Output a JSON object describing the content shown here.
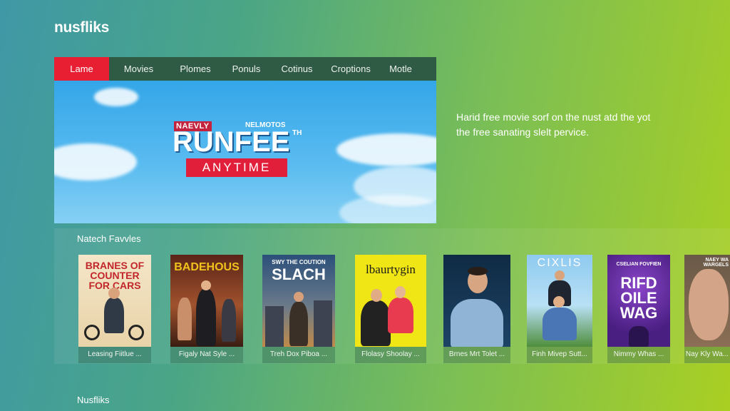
{
  "app": {
    "logo": "nusfliks"
  },
  "nav": {
    "items": [
      "Lame",
      "Movies",
      "Plomes",
      "Ponuls",
      "Cotinus",
      "Croptions",
      "Motle"
    ],
    "active_index": 0,
    "active_color": "#e81f33"
  },
  "hero": {
    "brand_left": "NAEVLY",
    "brand_right": "NELMOTOS",
    "title": "RUNFEE",
    "title_mark": "TH",
    "tagline": "ANYTIME"
  },
  "promo_text": "Harid free movie sorf on the nust atd the yot the free sanating slelt pervice.",
  "section": {
    "title": "Natech Favvles"
  },
  "cards": [
    {
      "poster_title": "BRANES OF COUNTER FOR CARS",
      "caption": "Leasing Fiitlue ..."
    },
    {
      "poster_title": "BADEHOUS",
      "caption": "Figaly Nat Syle ..."
    },
    {
      "poster_title": "SLACH",
      "poster_subtitle": "SWY THE COUTION",
      "caption": "Treh Dox Piboa ..."
    },
    {
      "poster_title": "lbaurtygin",
      "caption": "Flolasy Shoolay ..."
    },
    {
      "poster_title": "",
      "caption": "Brnes Mrt Tolet ..."
    },
    {
      "poster_title": "CIXLIS",
      "caption": "Finh Mivep Sutt..."
    },
    {
      "poster_title": "RIFD OILE WAG",
      "poster_subtitle": "CSELIAN FOVFIEN",
      "caption": "Nimmy Whas ..."
    },
    {
      "poster_title": "",
      "poster_subtitle": "NAEY WA WARGELS",
      "caption": "Nay Kly Wa..."
    }
  ],
  "footer": {
    "label": "Nusfliks"
  }
}
